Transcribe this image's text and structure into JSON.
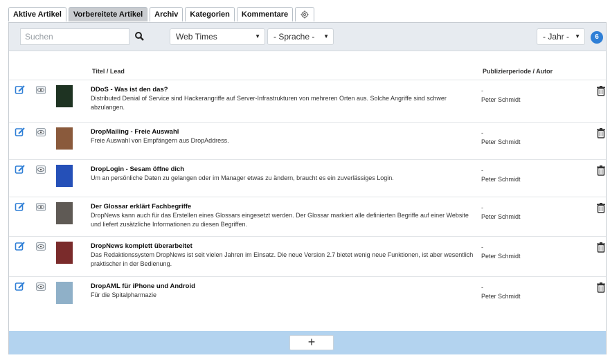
{
  "tabs": [
    {
      "label": "Aktive Artikel"
    },
    {
      "label": "Vorbereitete Artikel"
    },
    {
      "label": "Archiv"
    },
    {
      "label": "Kategorien"
    },
    {
      "label": "Kommentare"
    },
    {
      "icon": "gear-icon"
    }
  ],
  "toolbar": {
    "search_placeholder": "Suchen",
    "publication_select": "Web Times",
    "language_select": "- Sprache -",
    "year_select": "- Jahr -",
    "count_badge": "6"
  },
  "columns": {
    "title": "Titel / Lead",
    "period": "Publizierperiode / Autor"
  },
  "articles": [
    {
      "title": "DDoS - Was ist den das?",
      "lead": "Distributed Denial of Service sind Hackerangriffe auf Server-Infrastrukturen von mehreren Orten aus. Solche Angriffe sind schwer abzulangen.",
      "period": "-",
      "author": "Peter Schmidt",
      "thumb_color": "#1e3322"
    },
    {
      "title": "DropMailing - Freie Auswahl",
      "lead": "Freie Auswahl von Empfängern aus DropAddress.",
      "period": "-",
      "author": "Peter Schmidt",
      "thumb_color": "#8a5a3c"
    },
    {
      "title": "DropLogin - Sesam öffne dich",
      "lead": "Um an persönliche Daten zu gelangen oder im Manager etwas zu ändern, braucht es ein zuverlässiges Login.",
      "period": "-",
      "author": "Peter Schmidt",
      "thumb_color": "#2550b8"
    },
    {
      "title": "Der Glossar erklärt Fachbegriffe",
      "lead": "DropNews kann auch für das Erstellen eines Glossars eingesetzt werden. Der Glossar markiert alle definierten Begriffe auf einer Website und liefert zusätzliche Informationen zu diesen Begriffen.",
      "period": "-",
      "author": "Peter Schmidt",
      "thumb_color": "#5f5a55"
    },
    {
      "title": "DropNews komplett überarbeitet",
      "lead": "Das Redaktionssystem DropNews ist seit vielen Jahren im Einsatz. Die neue Version 2.7 bietet wenig neue Funktionen, ist aber wesentlich praktischer in der Bedienung.",
      "period": "-",
      "author": "Peter Schmidt",
      "thumb_color": "#7a2b2b"
    },
    {
      "title": "DropAML für iPhone und Android",
      "lead": "Für die Spitalpharmazie",
      "period": "-",
      "author": "Peter Schmidt",
      "thumb_color": "#8fb0c8"
    }
  ],
  "footer": {
    "add_label": "+"
  },
  "colors": {
    "accent": "#2f7fd6",
    "footer": "#b3d3ef",
    "toolbar": "#e7ebf0",
    "active_tab": "#c9ccd0"
  }
}
